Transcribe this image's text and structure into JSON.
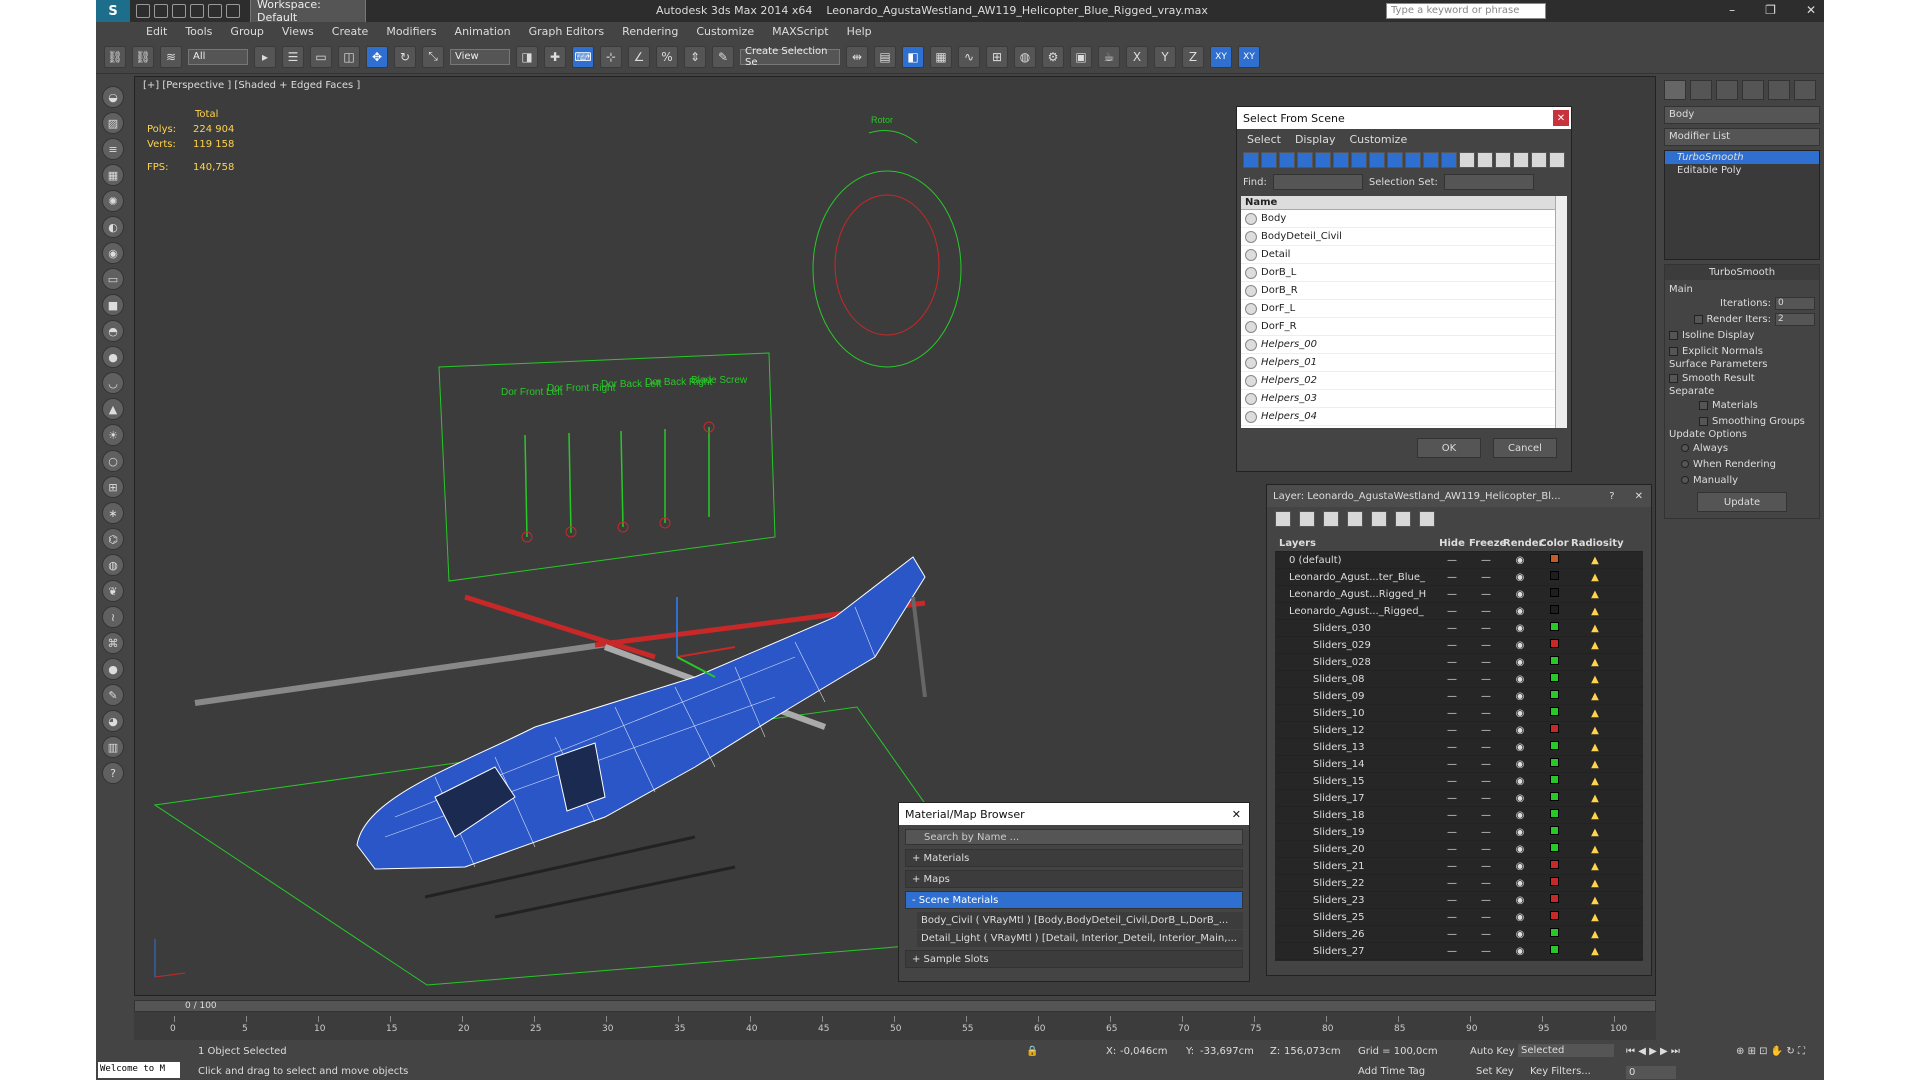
{
  "title": {
    "workspace": "Workspace: Default",
    "app": "Autodesk 3ds Max  2014 x64",
    "file": "Leonardo_AgustaWestland_AW119_Helicopter_Blue_Rigged_vray.max",
    "search_placeholder": "Type a keyword or phrase"
  },
  "menu": [
    "Edit",
    "Tools",
    "Group",
    "Views",
    "Create",
    "Modifiers",
    "Animation",
    "Graph Editors",
    "Rendering",
    "Customize",
    "MAXScript",
    "Help"
  ],
  "toolbar": {
    "filter": "All",
    "refcoord": "View",
    "named_set": "Create Selection Se",
    "axis_x": "X",
    "axis_y": "Y",
    "axis_z": "Z",
    "axis_xy": "XY",
    "axis_xy2": "XY"
  },
  "viewport": {
    "label": "[+] [Perspective ] [Shaded + Edged Faces ]",
    "stats": {
      "total": "Total",
      "polys_label": "Polys:",
      "polys": "224 904",
      "verts_label": "Verts:",
      "verts": "119 158",
      "fps_label": "FPS:",
      "fps": "140,758"
    },
    "rotor_label": "Rotor",
    "slider_labels": [
      "Dor Front Left",
      "Dor Front Right",
      "Dor Back Left",
      "Dor Back Right",
      "Blade Screw"
    ]
  },
  "select_from_scene": {
    "title": "Select From Scene",
    "tabs": [
      "Select",
      "Display",
      "Customize"
    ],
    "find_label": "Find:",
    "selset_label": "Selection Set:",
    "name_header": "Name",
    "items": [
      "Body",
      "BodyDeteil_Civil",
      "Detail",
      "DorB_L",
      "DorB_R",
      "DorF_L",
      "DorF_R",
      "Helpers_00",
      "Helpers_01",
      "Helpers_02",
      "Helpers_03",
      "Helpers_04"
    ],
    "ok": "OK",
    "cancel": "Cancel"
  },
  "layer_manager": {
    "title": "Layer: Leonardo_AgustaWestland_AW119_Helicopter_Bl...",
    "q": "?",
    "headers": [
      "Layers",
      "Hide",
      "Freeze",
      "Render",
      "Color",
      "Radiosity"
    ],
    "rows": [
      {
        "name": "0 (default)",
        "color": "#c85a28"
      },
      {
        "name": "Leonardo_Agust...ter_Blue_",
        "color": "#1e1e1e"
      },
      {
        "name": "Leonardo_Agust...Rigged_H",
        "color": "#1e1e1e"
      },
      {
        "name": "Leonardo_Agust..._Rigged_",
        "color": "#1e1e1e"
      },
      {
        "name": "Sliders_030",
        "color": "#28c828"
      },
      {
        "name": "Sliders_029",
        "color": "#c82828"
      },
      {
        "name": "Sliders_028",
        "color": "#28c828"
      },
      {
        "name": "Sliders_08",
        "color": "#28c828"
      },
      {
        "name": "Sliders_09",
        "color": "#28c828"
      },
      {
        "name": "Sliders_10",
        "color": "#28c828"
      },
      {
        "name": "Sliders_12",
        "color": "#c82828"
      },
      {
        "name": "Sliders_13",
        "color": "#28c828"
      },
      {
        "name": "Sliders_14",
        "color": "#28c828"
      },
      {
        "name": "Sliders_15",
        "color": "#28c828"
      },
      {
        "name": "Sliders_17",
        "color": "#28c828"
      },
      {
        "name": "Sliders_18",
        "color": "#28c828"
      },
      {
        "name": "Sliders_19",
        "color": "#28c828"
      },
      {
        "name": "Sliders_20",
        "color": "#28c828"
      },
      {
        "name": "Sliders_21",
        "color": "#c82828"
      },
      {
        "name": "Sliders_22",
        "color": "#c82828"
      },
      {
        "name": "Sliders_23",
        "color": "#c82828"
      },
      {
        "name": "Sliders_25",
        "color": "#c82828"
      },
      {
        "name": "Sliders_26",
        "color": "#28c828"
      },
      {
        "name": "Sliders_27",
        "color": "#28c828"
      }
    ]
  },
  "material_browser": {
    "title": "Material/Map Browser",
    "search": "Search by Name ...",
    "sections": [
      "+ Materials",
      "+ Maps",
      "- Scene Materials"
    ],
    "items": [
      "Body_Civil  ( VRayMtl )  [Body,BodyDeteil_Civil,DorB_L,DorB_...",
      "Detail_Light  ( VRayMtl )  [Detail, Interior_Deteil, Interior_Main,..."
    ],
    "sample": "+ Sample Slots"
  },
  "command_panel": {
    "object": "Body",
    "modifier_list": "Modifier List",
    "stack": [
      "TurboSmooth",
      "Editable Poly"
    ],
    "rollout_title": "TurboSmooth",
    "main": "Main",
    "iterations_label": "Iterations:",
    "iterations": "0",
    "render_iters_label": "Render Iters:",
    "render_iters": "2",
    "isoline": "Isoline Display",
    "explicit": "Explicit Normals",
    "surface": "Surface Parameters",
    "smooth": "Smooth Result",
    "separate": "Separate",
    "materials": "Materials",
    "smoothing": "Smoothing Groups",
    "update_options": "Update Options",
    "always": "Always",
    "when_rendering": "When Rendering",
    "manually": "Manually",
    "update": "Update"
  },
  "timeline": {
    "frame": "0 / 100",
    "ticks": [
      "0",
      "5",
      "10",
      "15",
      "20",
      "25",
      "30",
      "35",
      "40",
      "45",
      "50",
      "55",
      "60",
      "65",
      "70",
      "75",
      "80",
      "85",
      "90",
      "95",
      "100"
    ]
  },
  "status": {
    "maxscript": "Welcome to M",
    "selected": "1 Object Selected",
    "prompt": "Click and drag to select and move objects",
    "x_label": "X:",
    "x": "-0,046cm",
    "y_label": "Y:",
    "y": "-33,697cm",
    "z_label": "Z:",
    "z": "156,073cm",
    "grid": "Grid = 100,0cm",
    "add_time_tag": "Add Time Tag",
    "autokey": "Auto Key",
    "setkey": "Set Key",
    "selected_dd": "Selected",
    "key_filters": "Key Filters...",
    "frame": "0"
  },
  "colors": {
    "accent": "#2f6fd0",
    "wire_blue": "#2a56c8",
    "green": "#28c828"
  }
}
